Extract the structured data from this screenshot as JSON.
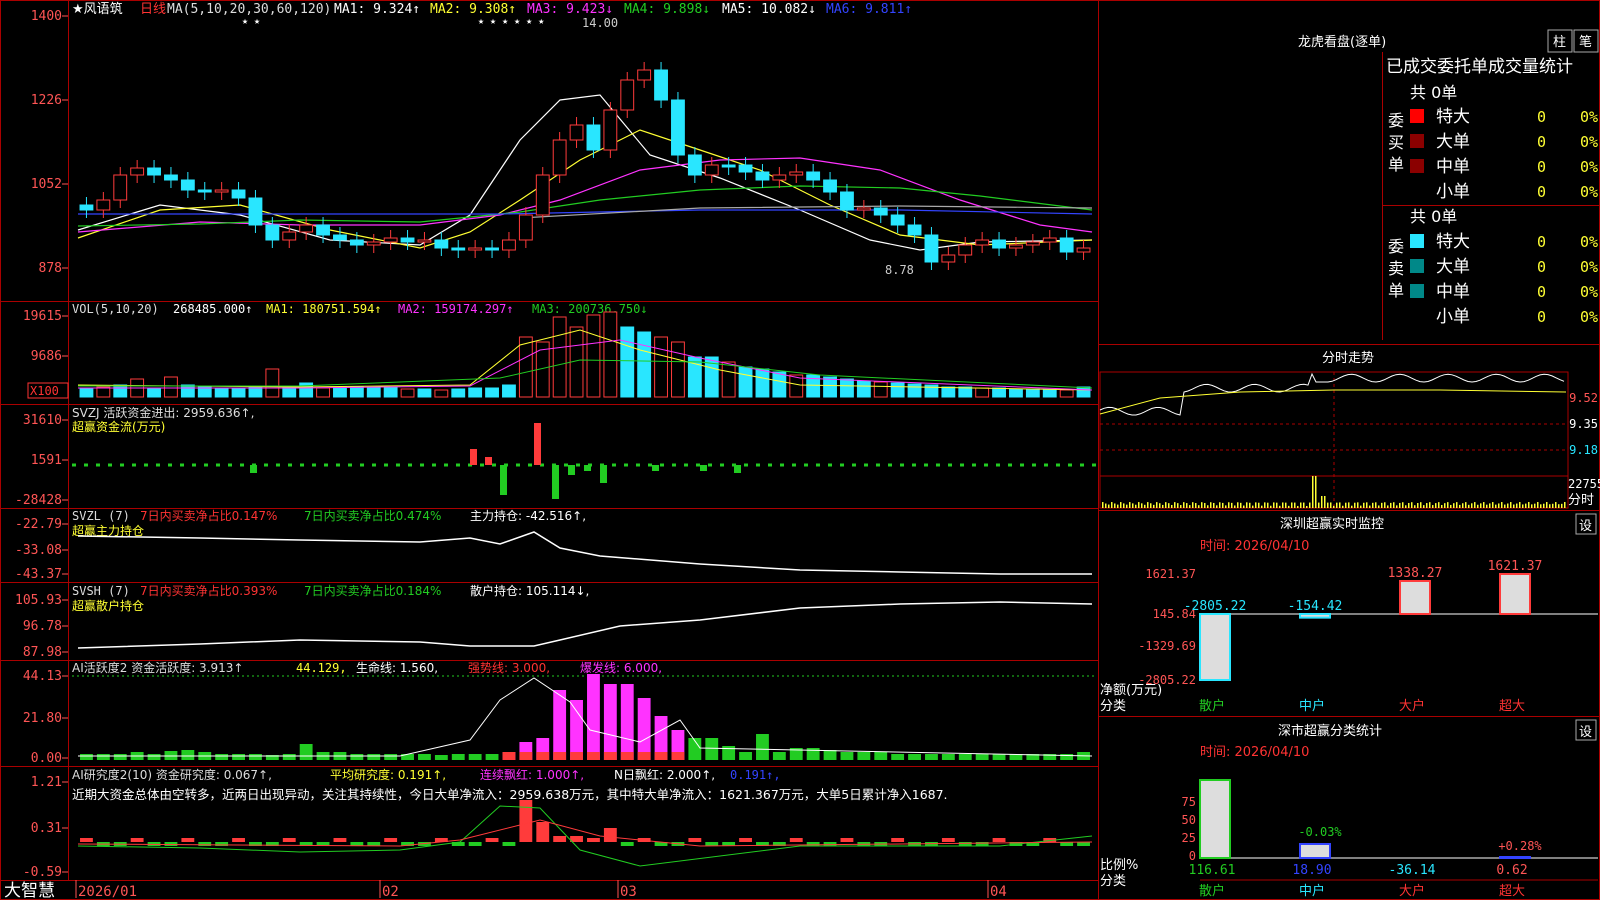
{
  "colors": {
    "up": "#ff3b3b",
    "down": "#29e6ff",
    "grid": "#8b0000",
    "axis": "#ff5555",
    "white": "#ffffff",
    "yellow": "#ffff33",
    "magenta": "#ff33ff",
    "green": "#22cc22",
    "cyan": "#29e6ff",
    "blue": "#3344ff",
    "gray": "#aaaaaa"
  },
  "main": {
    "stock_label": "★风语筑",
    "period": "日线",
    "ma_params": "MA(5,10,20,30,60,120)",
    "ma_items": [
      {
        "text": "MA1: 9.324↑",
        "color": "#ffffff"
      },
      {
        "text": "MA2: 9.308↑",
        "color": "#ffff33"
      },
      {
        "text": "MA3: 9.423↓",
        "color": "#ff33ff"
      },
      {
        "text": "MA4: 9.898↓",
        "color": "#22cc22"
      },
      {
        "text": "MA5: 10.082↓",
        "color": "#ffffff"
      },
      {
        "text": "MA6: 9.811↑",
        "color": "#3344ff"
      }
    ],
    "y_ticks": [
      "1400",
      "1226",
      "1052",
      "878"
    ],
    "high_label": "14.00",
    "low_label": "8.78",
    "star_marks": "★   ★",
    "star_marks2": "★ ★ ★ ★ ★ ★"
  },
  "vol": {
    "header": "VOL(5,10,20)",
    "value": "268485.000↑",
    "ma_items": [
      {
        "text": "MA1: 180751.594↑",
        "color": "#ffff33"
      },
      {
        "text": "MA2: 159174.297↑",
        "color": "#ff33ff"
      },
      {
        "text": "MA3: 200736.750↓",
        "color": "#22cc22"
      }
    ],
    "y_ticks": [
      "19615",
      "9686"
    ],
    "unit": "X100"
  },
  "svzj": {
    "header": "SVZJ  活跃资金进出: 2959.636↑,",
    "sub": "超赢资金流(万元)",
    "y_ticks": [
      "31610",
      "1591",
      "-28428"
    ]
  },
  "svzl": {
    "header": "SVZL (7)",
    "a": "7日内买卖净占比0.147%",
    "b": "7日内买卖净占比0.474%",
    "c": "主力持仓: -42.516↑,",
    "sub": "超赢主力持仓",
    "y_ticks": [
      "-22.79",
      "-33.08",
      "-43.37"
    ]
  },
  "svsh": {
    "header": "SVSH (7)",
    "a": "7日内买卖净占比0.393%",
    "b": "7日内买卖净占比0.184%",
    "c": "散户持仓: 105.114↓,",
    "sub": "超赢散户持仓",
    "y_ticks": [
      "105.93",
      "96.78",
      "87.98"
    ]
  },
  "ai1": {
    "header": "AI活跃度2 资金活跃度: 3.913↑",
    "v2": "44.129,",
    "v3": "生命线: 1.560,",
    "v4": "强势线: 3.000,",
    "v5": "爆发线: 6.000,",
    "y_ticks": [
      "44.13",
      "21.80",
      "0.00"
    ]
  },
  "ai2": {
    "header": "AI研究度2(10) 资金研究度: 0.067↑,",
    "v2": "平均研究度: 0.191↑,",
    "v3": "连续飘红: 1.000↑,",
    "v4": "N日飘红: 2.000↑,",
    "v5": "0.191↑,",
    "note": "近期大资金总体由空转多，近两日出现异动，关注其持续性，今日大单净流入：2959.638万元，其中特大单净流入：1621.367万元，大单5日累计净入1687.",
    "y_ticks": [
      "1.21",
      "0.31",
      "-0.59"
    ]
  },
  "bottom": {
    "brand": "大智慧",
    "dates": [
      "2026/01",
      "02",
      "03",
      "04"
    ]
  },
  "right": {
    "lhb_title": "龙虎看盘(逐单)",
    "btn_zhu": "柱",
    "btn_bi": "笔",
    "tabs_line": "已成交委托单成交量统计",
    "buy": {
      "side": "委买单",
      "total": "共 0单",
      "rows": [
        {
          "name": "特大",
          "count": "0",
          "pct": "0%",
          "color": "#ff0000"
        },
        {
          "name": "大单",
          "count": "0",
          "pct": "0%",
          "color": "#8b0000"
        },
        {
          "name": "中单",
          "count": "0",
          "pct": "0%",
          "color": "#8b0000"
        },
        {
          "name": "小单",
          "count": "0",
          "pct": "0%",
          "color": "#000000"
        }
      ]
    },
    "sell": {
      "side": "委卖单",
      "total": "共 0单",
      "rows": [
        {
          "name": "特大",
          "count": "0",
          "pct": "0%",
          "color": "#29e6ff"
        },
        {
          "name": "大单",
          "count": "0",
          "pct": "0%",
          "color": "#008888"
        },
        {
          "name": "中单",
          "count": "0",
          "pct": "0%",
          "color": "#008888"
        },
        {
          "name": "小单",
          "count": "0",
          "pct": "0%",
          "color": "#000000"
        }
      ]
    },
    "intraday": {
      "title": "分时走势",
      "y_ticks": [
        "9.52",
        "9.35",
        "9.18"
      ],
      "vol_label": "22755",
      "vol_unit": "分时"
    },
    "sz_monitor": {
      "title": "深圳超赢实时监控",
      "time": "时间: 2026/04/10",
      "btn": "设",
      "y_ticks": [
        "1621.37",
        "145.84",
        "-1329.69",
        "-2805.22"
      ],
      "ylabel": "净额(万元)",
      "xlabel": "分类",
      "categories": [
        "散户",
        "中户",
        "大户",
        "超大"
      ],
      "values": [
        -2805.22,
        -154.42,
        1338.27,
        1621.37
      ],
      "value_labels": [
        "-2805.22",
        "-154.42",
        "1338.27",
        "1621.37"
      ]
    },
    "sz_stats": {
      "title": "深市超赢分类统计",
      "time": "时间: 2026/04/10",
      "btn": "设",
      "y_ticks": [
        "75",
        "50",
        "25",
        "0"
      ],
      "ylabel": "比例%",
      "xlabel": "分类",
      "categories": [
        "散户",
        "中户",
        "大户",
        "超大"
      ],
      "bottom_values": [
        "116.61",
        "18.90",
        "-36.14",
        "0.62"
      ],
      "pct_labels": [
        "",
        "-0.03%",
        "",
        "+0.28%"
      ]
    }
  }
}
